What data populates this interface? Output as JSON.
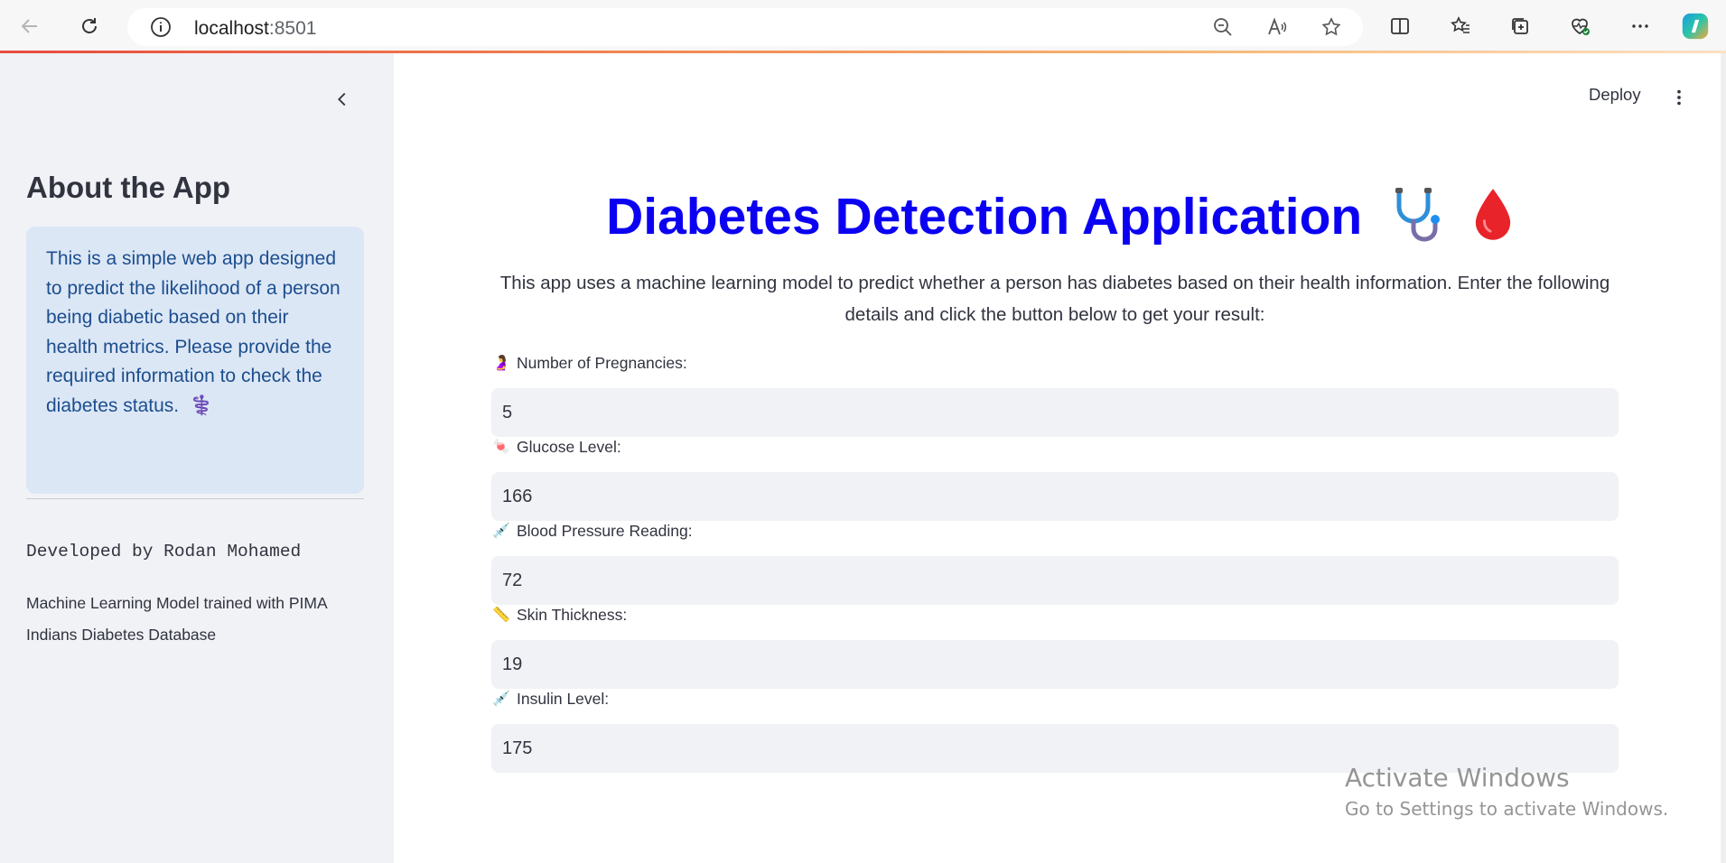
{
  "browser": {
    "url_host": "localhost",
    "url_port": ":8501",
    "icons": [
      "back-icon",
      "refresh-icon",
      "info-icon",
      "zoom-out-icon",
      "read-aloud-icon",
      "star-icon",
      "split-screen-icon",
      "favorites-icon",
      "collections-icon",
      "health-icon",
      "more-icon",
      "copilot-icon"
    ]
  },
  "sidebar": {
    "title": "About the App",
    "info_text": "This is a simple web app designed to predict the likelihood of a person being diabetic based on their health metrics. Please provide the required information to check the diabetes status.",
    "info_emoji": "⚕️",
    "developer": "Developed by Rodan Mohamed",
    "model_note": "Machine Learning Model trained with PIMA Indians Diabetes Database"
  },
  "header": {
    "deploy_label": "Deploy"
  },
  "main": {
    "title": "Diabetes Detection Application",
    "title_emojis": [
      "🩺",
      "🩸"
    ],
    "intro": "This app uses a machine learning model to predict whether a person has diabetes based on their health information. Enter the following details and click the button below to get your result:",
    "fields": [
      {
        "emoji": "🤰",
        "label": "Number of Pregnancies:",
        "value": "5"
      },
      {
        "emoji": "🍬",
        "label": "Glucose Level:",
        "value": "166"
      },
      {
        "emoji": "💉",
        "label": "Blood Pressure Reading:",
        "value": "72"
      },
      {
        "emoji": "📏",
        "label": "Skin Thickness:",
        "value": "19"
      },
      {
        "emoji": "💉",
        "label": "Insulin Level:",
        "value": "175"
      }
    ]
  },
  "watermark": {
    "title": "Activate Windows",
    "subtitle": "Go to Settings to activate Windows."
  },
  "colors": {
    "title": "#0b00f2",
    "sidebar_bg": "#f0f2f6",
    "info_bg": "#dce7f6",
    "info_text": "#1c4e8d",
    "input_bg": "#f0f2f6"
  }
}
